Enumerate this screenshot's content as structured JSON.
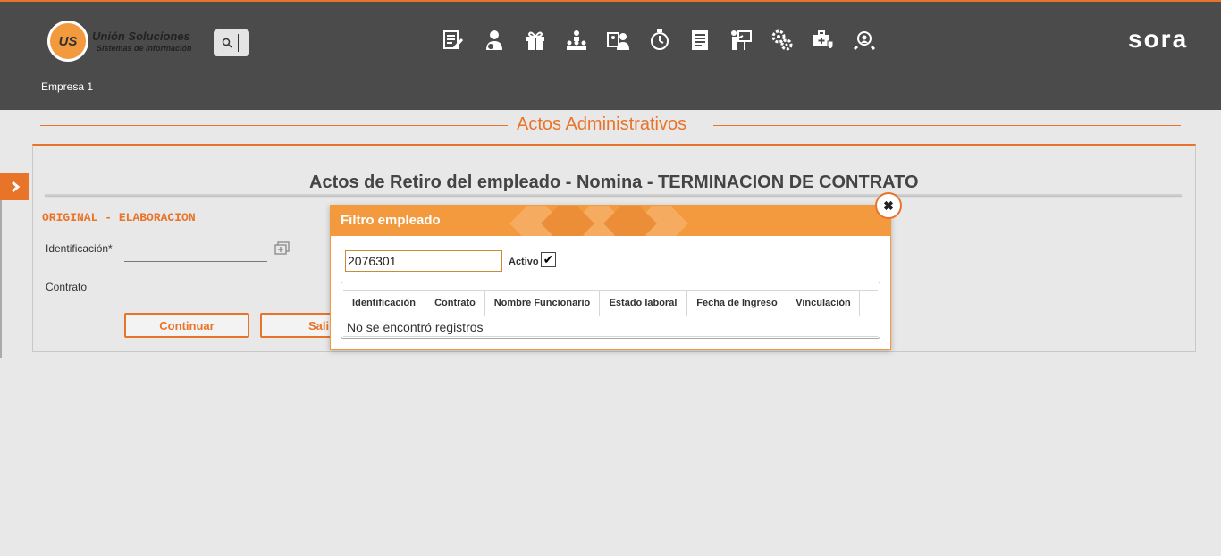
{
  "header": {
    "logo_mark": "US",
    "logo_name": "Unión Soluciones",
    "logo_subtitle": "Sistemas de Información",
    "brand": "sora",
    "company": "Empresa 1",
    "nav_icons": [
      "document-edit-icon",
      "user-money-icon",
      "gift-icon",
      "org-chart-icon",
      "id-card-user-icon",
      "timer-icon",
      "report-icon",
      "presentation-icon",
      "settings-gears-icon",
      "medical-kit-icon",
      "search-users-icon"
    ]
  },
  "page": {
    "section_title": "Actos Administrativos",
    "form_title": "Actos de Retiro del empleado - Nomina - TERMINACION DE CONTRATO",
    "status": "ORIGINAL - ELABORACION",
    "fields": {
      "identificacion_label": "Identificación*",
      "contrato_label": "Contrato"
    },
    "buttons": {
      "continuar": "Continuar",
      "salir": "Sali"
    }
  },
  "modal": {
    "title": "Filtro empleado",
    "filter_value": "2076301",
    "activo_label": "Activo",
    "activo_checked": true,
    "columns": [
      "Identificación",
      "Contrato",
      "Nombre Funcionario",
      "Estado laboral",
      "Fecha de Ingreso",
      "Vinculación"
    ],
    "empty_message": "No se encontró registros"
  },
  "colors": {
    "accent": "#e8742a",
    "header_bg": "#4b4b4b",
    "modal_header": "#f39a3e",
    "page_bg": "#e8e8e8"
  }
}
